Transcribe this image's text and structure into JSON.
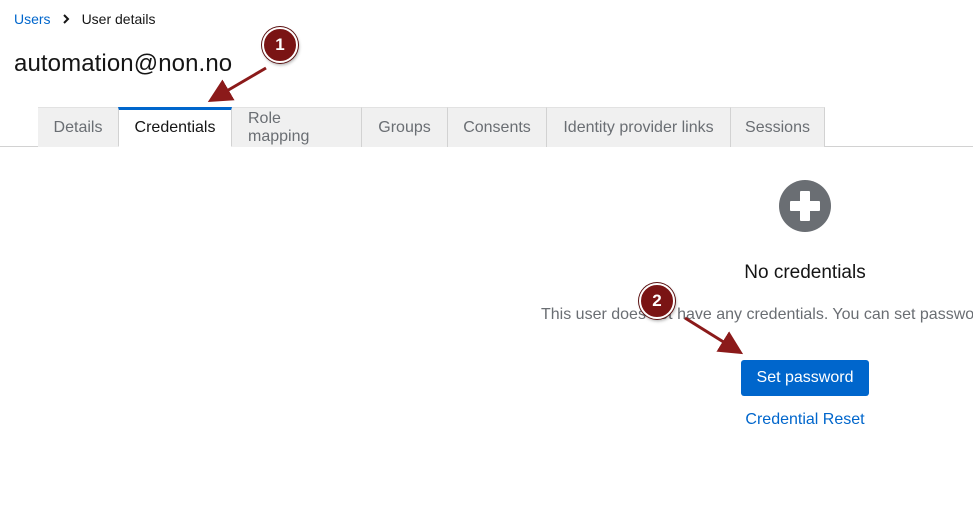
{
  "breadcrumb": {
    "parent_label": "Users",
    "current_label": "User details"
  },
  "page": {
    "title": "automation@non.no"
  },
  "tabs": [
    {
      "label": "Details",
      "active": false
    },
    {
      "label": "Credentials",
      "active": true
    },
    {
      "label": "Role mapping",
      "active": false
    },
    {
      "label": "Groups",
      "active": false
    },
    {
      "label": "Consents",
      "active": false
    },
    {
      "label": "Identity provider links",
      "active": false
    },
    {
      "label": "Sessions",
      "active": false
    }
  ],
  "empty_state": {
    "icon": "plus-circle-icon",
    "title": "No credentials",
    "body": "This user does not have any credentials. You can set password",
    "primary_action_label": "Set password",
    "secondary_action_label": "Credential Reset"
  },
  "annotations": {
    "marker_1_label": "1",
    "marker_2_label": "2",
    "marker_color": "#7a1414"
  },
  "colors": {
    "link": "#0066cc",
    "primary_button": "#0066cc",
    "tab_inactive_bg": "#f0f0f0",
    "icon_gray": "#6a6e73"
  }
}
